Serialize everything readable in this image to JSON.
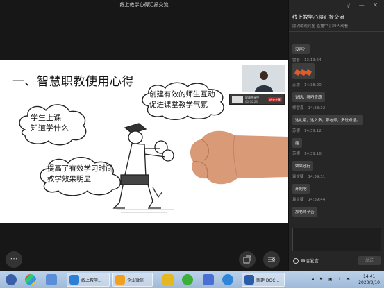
{
  "stream": {
    "title": "线上教学心得汇报交流"
  },
  "slide": {
    "heading": "一、智慧职教使用心得",
    "clouds": [
      {
        "lines": [
          "创建有效的师生互动",
          "促进课堂教学气氛"
        ]
      },
      {
        "lines": [
          "学生上课",
          "知道学什么"
        ]
      },
      {
        "lines": [
          "提高了有效学习时间",
          "教学效果明显"
        ]
      }
    ]
  },
  "mini_bar": {
    "label": "屏幕共享中",
    "time": "00:00:23",
    "end_label": "结束共享"
  },
  "controls": {
    "more_icon": "ellipsis-icon",
    "window_icon": "window-icon",
    "view_icon": "view-icon"
  },
  "panel": {
    "room_title": "线上教学心得汇报交流",
    "room_sub": "席玥璐晓亮图 直播中 | 39人观看",
    "window_buttons": "⚲ — ✕"
  },
  "messages": [
    {
      "name": "",
      "time": "",
      "text": "没声？",
      "emoji": false
    },
    {
      "name": "雷春",
      "time": "13:13:54",
      "text": "",
      "emoji": true
    },
    {
      "name": "苏娜",
      "time": "14:38:20",
      "text": "说话，听听音质",
      "emoji": false
    },
    {
      "name": "柳智鑫",
      "time": "14:38:32",
      "text": "这礼哦，这么多，那老师，多说点话。",
      "emoji": false
    },
    {
      "name": "苏娜",
      "time": "14:39:12",
      "text": "能",
      "emoji": false
    },
    {
      "name": "苏娜",
      "time": "14:39:16",
      "text": "效果还行",
      "emoji": false
    },
    {
      "name": "袁文婕",
      "time": "14:39:31",
      "text": "开始吧",
      "emoji": false
    },
    {
      "name": "袁文婕",
      "time": "14:39:44",
      "text": "那老师辛苦",
      "emoji": false
    }
  ],
  "chat_input": {
    "apply_label": "申请发言",
    "send_label": "发送"
  },
  "taskbar": {
    "tasks": [
      {
        "label": "线上教学..."
      },
      {
        "label": "企业微信"
      },
      {
        "label": "新建 DOC..."
      }
    ],
    "clock_time": "14:41",
    "clock_date": "2020/3/10"
  },
  "colors": {
    "panel_bg": "#262626",
    "bubble_bg": "#3d3d3d",
    "taskbar_bg": "#a9c2de"
  }
}
